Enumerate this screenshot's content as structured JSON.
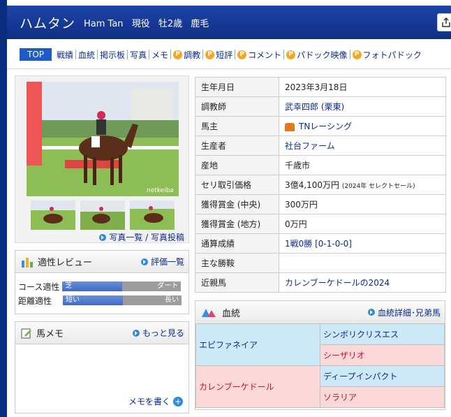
{
  "header": {
    "name": "ハムタン",
    "english_name": "Ham Tan",
    "status": "現役",
    "sex_age": "牡2歳",
    "coat": "鹿毛"
  },
  "nav": {
    "top": "TOP",
    "items": [
      "戦績",
      "血統",
      "掲示板",
      "写真",
      "メモ"
    ],
    "premium": [
      "調教",
      "短評",
      "コメント",
      "パドック映像",
      "フォトパドック"
    ]
  },
  "photos": {
    "watermark": "netkeiba",
    "links": "写真一覧 / 写真投稿"
  },
  "aptitude": {
    "title": "適性レビュー",
    "link": "評価一覧",
    "course_label": "コース適性",
    "course_left": "芝",
    "course_right": "ダート",
    "course_value": 0.5,
    "distance_label": "距離適性",
    "distance_left": "短い",
    "distance_right": "長い",
    "distance_value": 0.5
  },
  "memo": {
    "title": "馬メモ",
    "link": "もっと見る",
    "write": "メモを書く"
  },
  "profile": {
    "birth_label": "生年月日",
    "birth": "2023年3月18日",
    "trainer_label": "調教師",
    "trainer": "武幸四郎 (栗東)",
    "owner_label": "馬主",
    "owner": "TNレーシング",
    "breeder_label": "生産者",
    "breeder": "社台ファーム",
    "origin_label": "産地",
    "origin": "千歳市",
    "sale_label": "セリ取引価格",
    "sale": "3億4,100万円",
    "sale_note": "(2024年 セレクトセール)",
    "prize_central_label": "獲得賞金 (中央)",
    "prize_central": "300万円",
    "prize_local_label": "獲得賞金 (地方)",
    "prize_local": "0万円",
    "record_label": "通算成績",
    "record": "1戦0勝 [0-1-0-0]",
    "wins_label": "主な勝鞍",
    "wins": "",
    "relatives_label": "近親馬",
    "relatives": "カレンブーケドールの2024"
  },
  "pedigree": {
    "title": "血統",
    "link": "血統詳細･兄弟馬",
    "sire": "エピファネイア",
    "sire_sire": "シンボリクリスエス",
    "sire_dam": "シーザリオ",
    "dam": "カレンブーケドール",
    "dam_sire": "ディープインパクト",
    "dam_dam": "ソラリア"
  },
  "colors": {
    "header": "#0f2f85",
    "accent": "#1e5bc6",
    "sire_bg": "#cde9f8",
    "dam_bg": "#fbd9d9"
  }
}
